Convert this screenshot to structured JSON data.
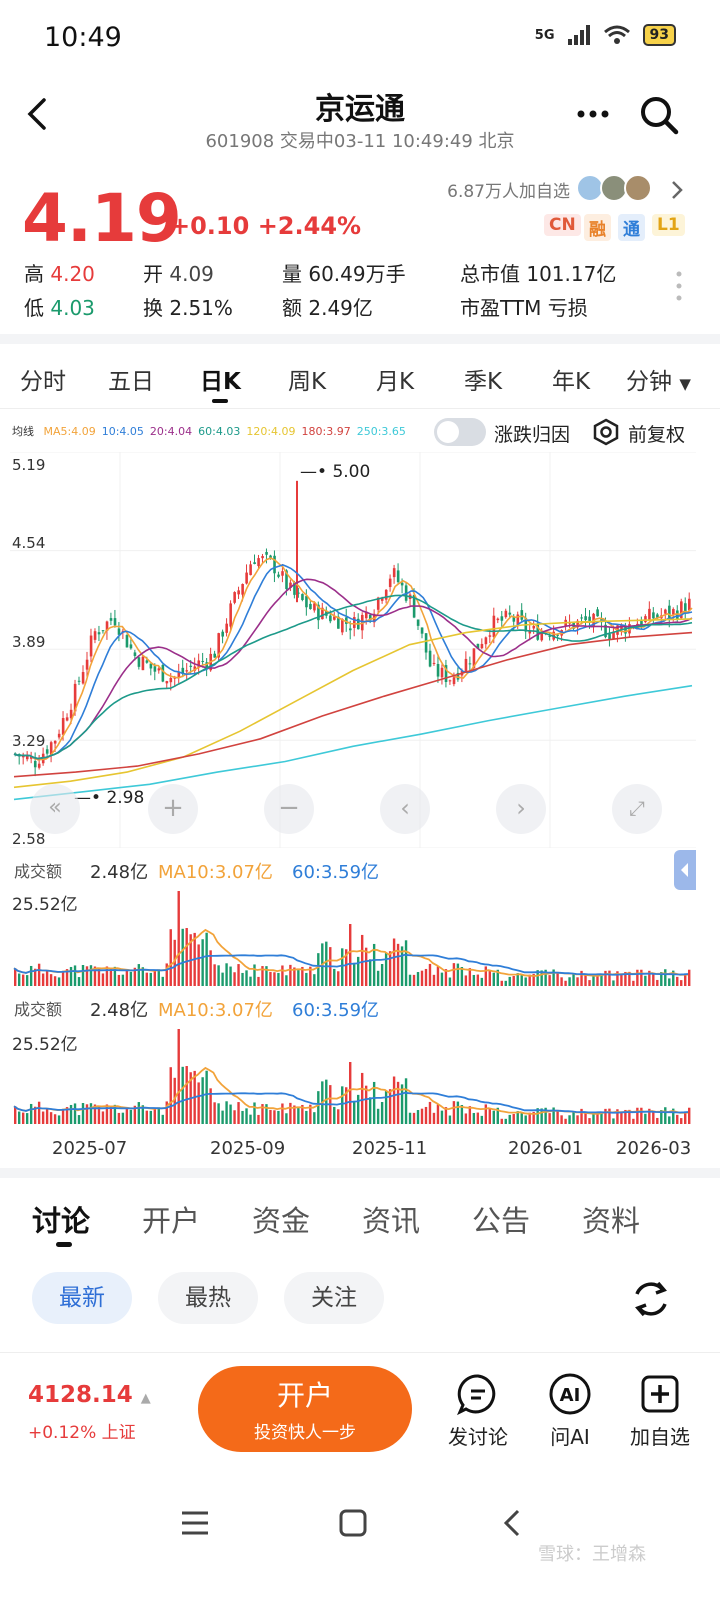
{
  "status": {
    "time": "10:49",
    "network": "5G",
    "battery": "93"
  },
  "header": {
    "title": "京运通",
    "subtitle": "601908 交易中03-11 10:49:49 北京"
  },
  "quote": {
    "price": "4.19",
    "change": "+0.10",
    "change_pct": "+2.44%",
    "followers": "6.87万人加自选",
    "badges": [
      "CN",
      "融",
      "通",
      "L1"
    ],
    "high_label": "高",
    "high": "4.20",
    "low_label": "低",
    "low": "4.03",
    "open_label": "开",
    "open": "4.09",
    "turnover_label": "换",
    "turnover": "2.51%",
    "volume_label": "量",
    "volume": "60.49万手",
    "amount_label": "额",
    "amount": "2.49亿",
    "mcap_label": "总市值",
    "mcap": "101.17亿",
    "pe_label": "市盈TTM",
    "pe": "亏损"
  },
  "period_tabs": [
    "分时",
    "五日",
    "日K",
    "周K",
    "月K",
    "季K",
    "年K",
    "分钟"
  ],
  "ma_legend": {
    "label": "均线",
    "items": [
      {
        "text": "MA5:4.09",
        "color": "#f2a33a"
      },
      {
        "text": "10:4.05",
        "color": "#2f7ed8"
      },
      {
        "text": "20:4.04",
        "color": "#9b2f8a"
      },
      {
        "text": "60:4.03",
        "color": "#1d9a8a"
      },
      {
        "text": "120:4.09",
        "color": "#e6c531"
      },
      {
        "text": "180:3.97",
        "color": "#d1433f"
      },
      {
        "text": "250:3.65",
        "color": "#3ec9d8"
      }
    ]
  },
  "toggle_label": "涨跌归因",
  "adjust_label": "前复权",
  "chart_data": {
    "type": "candlestick",
    "y_ticks": [
      "5.19",
      "4.54",
      "3.89",
      "3.29",
      "2.58"
    ],
    "ylim": [
      2.58,
      5.19
    ],
    "high_marker": "5.00",
    "low_marker": "2.98",
    "x_ticks": [
      "2025-07",
      "2025-09",
      "2025-11",
      "2026-01",
      "2026-03"
    ],
    "close_path": [
      3.2,
      3.15,
      3.3,
      3.6,
      4.0,
      4.1,
      3.85,
      3.75,
      3.7,
      3.78,
      3.85,
      4.2,
      4.5,
      4.45,
      4.25,
      4.15,
      4.1,
      4.05,
      4.15,
      4.4,
      4.2,
      3.75,
      3.7,
      3.85,
      4.05,
      4.1,
      4.0,
      4.02,
      4.05,
      4.08,
      4.0,
      4.05,
      4.1,
      4.12,
      4.19
    ],
    "ma120": [
      2.98,
      3.02,
      3.08,
      3.18,
      3.35,
      3.55,
      3.75,
      3.92,
      4.0,
      4.05,
      4.07,
      4.08,
      4.09
    ],
    "ma180": [
      3.05,
      3.08,
      3.12,
      3.2,
      3.3,
      3.45,
      3.58,
      3.7,
      3.82,
      3.92,
      3.97,
      4.0
    ],
    "ma250": [
      2.9,
      2.95,
      3.0,
      3.08,
      3.15,
      3.25,
      3.33,
      3.42,
      3.5,
      3.58,
      3.65
    ]
  },
  "volume": {
    "label": "成交额",
    "value": "2.48亿",
    "ma10": "MA10:3.07亿",
    "ma60": "60:3.59亿",
    "max": "25.52亿"
  },
  "bottom_tabs": [
    "讨论",
    "开户",
    "资金",
    "资讯",
    "公告",
    "资料"
  ],
  "filter_pills": [
    "最新",
    "最热",
    "关注"
  ],
  "index": {
    "value": "4128.14",
    "change": "+0.12% 上证"
  },
  "cta": {
    "title": "开户",
    "subtitle": "投资快人一步"
  },
  "actions": [
    "发讨论",
    "问AI",
    "加自选"
  ],
  "watermark": "雪球：王增森"
}
